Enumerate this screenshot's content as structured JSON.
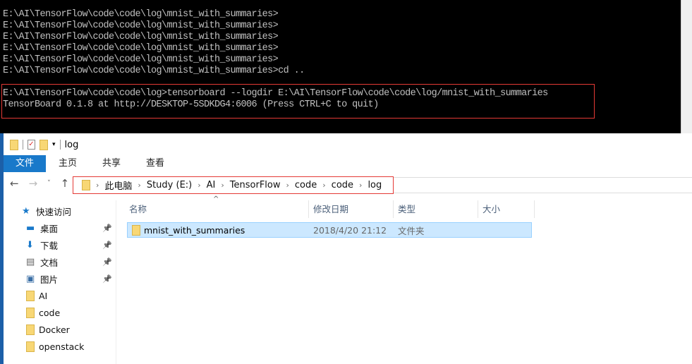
{
  "console": {
    "lines": [
      "E:\\AI\\TensorFlow\\code\\code\\log\\mnist_with_summaries>",
      "E:\\AI\\TensorFlow\\code\\code\\log\\mnist_with_summaries>",
      "E:\\AI\\TensorFlow\\code\\code\\log\\mnist_with_summaries>",
      "E:\\AI\\TensorFlow\\code\\code\\log\\mnist_with_summaries>",
      "E:\\AI\\TensorFlow\\code\\code\\log\\mnist_with_summaries>",
      "E:\\AI\\TensorFlow\\code\\code\\log\\mnist_with_summaries>cd ..",
      "",
      "E:\\AI\\TensorFlow\\code\\code\\log>tensorboard --logdir E:\\AI\\TensorFlow\\code\\code\\log/mnist_with_summaries",
      "TensorBoard 0.1.8 at http://DESKTOP-5SDKDG4:6006 (Press CTRL+C to quit)"
    ],
    "highlight_color": "#e53935"
  },
  "explorer": {
    "title": "log",
    "tabs": [
      "文件",
      "主页",
      "共享",
      "查看"
    ],
    "breadcrumb": [
      "此电脑",
      "Study (E:)",
      "AI",
      "TensorFlow",
      "code",
      "code",
      "log"
    ],
    "sidebar": [
      {
        "label": "快速访问",
        "icon": "star-icon"
      },
      {
        "label": "桌面",
        "icon": "desktop-icon",
        "pinned": true
      },
      {
        "label": "下载",
        "icon": "download-icon",
        "pinned": true
      },
      {
        "label": "文档",
        "icon": "document-icon",
        "pinned": true
      },
      {
        "label": "图片",
        "icon": "picture-icon",
        "pinned": true
      },
      {
        "label": "AI",
        "icon": "folder-icon"
      },
      {
        "label": "code",
        "icon": "folder-icon"
      },
      {
        "label": "Docker",
        "icon": "folder-icon"
      },
      {
        "label": "openstack",
        "icon": "folder-icon"
      }
    ],
    "columns": [
      "名称",
      "修改日期",
      "类型",
      "大小"
    ],
    "files": [
      {
        "name": "mnist_with_summaries",
        "date": "2018/4/20 21:12",
        "type": "文件夹",
        "size": ""
      }
    ]
  }
}
